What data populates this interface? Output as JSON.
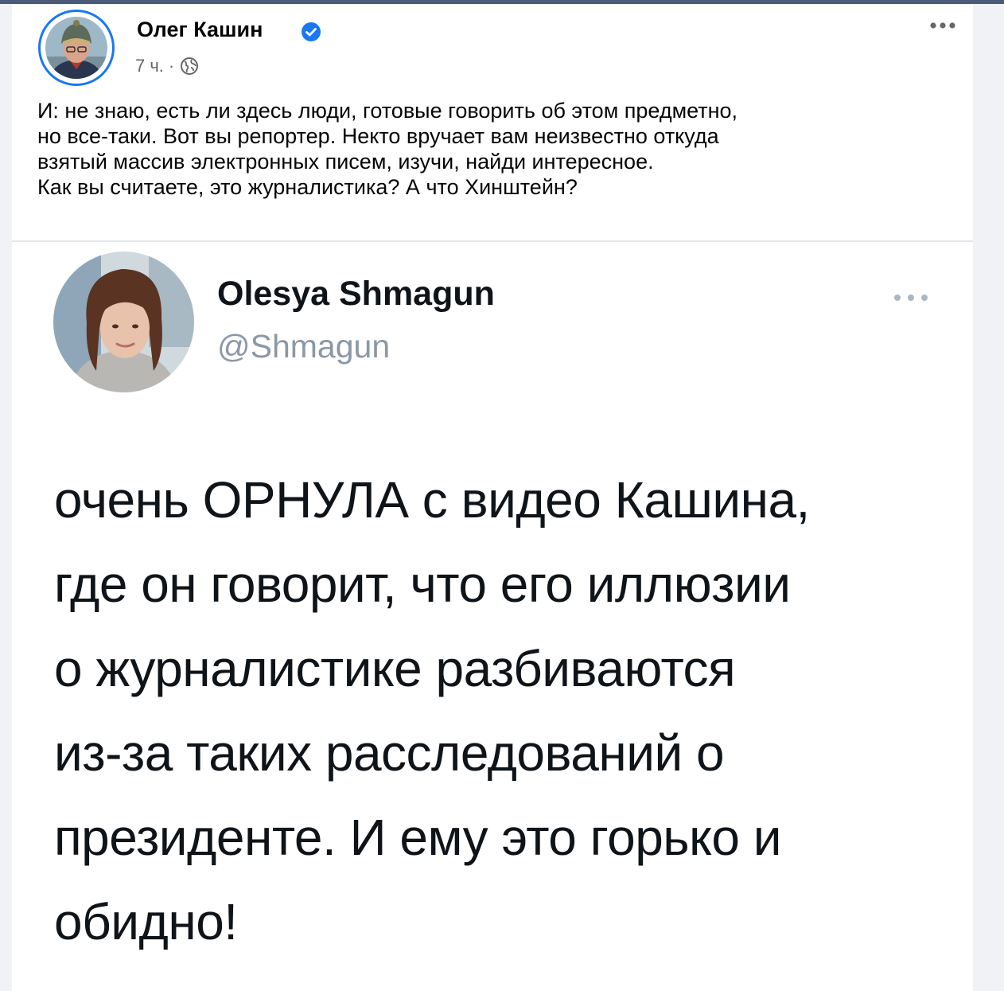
{
  "post": {
    "author_name": "Олег Кашин",
    "time": "7 ч.",
    "separator": "·",
    "text_lines": [
      "И: не знаю, есть ли здесь люди, готовые говорить об этом предметно,",
      "но все-таки. Вот вы репортер. Некто вручает вам неизвестно откуда",
      "взятый массив электронных писем, изучи, найди интересное.",
      "Как вы считаете, это журналистика? А что Хинштейн?"
    ]
  },
  "tweet": {
    "name": "Olesya Shmagun",
    "handle": "@Shmagun",
    "text_lines": [
      "очень ОРНУЛА с видео Кашина,",
      "где он говорит, что его иллюзии",
      "о журналистике разбиваются",
      "из-за таких расследований о",
      "президенте. И ему это горько и",
      "обидно!"
    ]
  },
  "icons": {
    "verified": "verified-badge-icon",
    "audience": "globe-icon",
    "post_menu": "more-options-icon",
    "tweet_menu": "more-options-icon"
  },
  "colors": {
    "facebook_blue": "#1877f2",
    "meta_gray": "#65676b",
    "twitter_handle_gray": "#8b98a5",
    "feed_background": "#f0f2f5"
  }
}
